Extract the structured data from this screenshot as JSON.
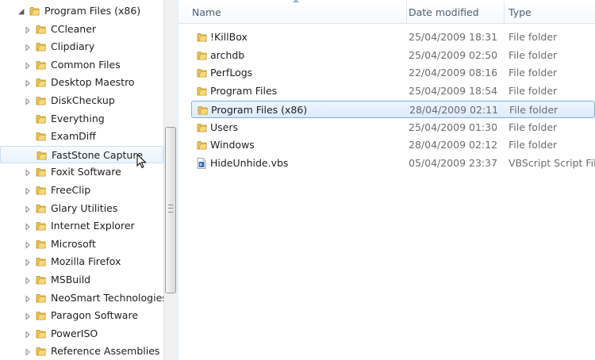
{
  "nav": {
    "items": [
      {
        "label": "Program Files (x86)",
        "expanded": true,
        "indent": 0
      },
      {
        "label": "CCleaner",
        "expandable": true
      },
      {
        "label": "Clipdiary",
        "expandable": true
      },
      {
        "label": "Common Files",
        "expandable": true
      },
      {
        "label": "Desktop Maestro",
        "expandable": true
      },
      {
        "label": "DiskCheckup",
        "expandable": true
      },
      {
        "label": "Everything",
        "expandable": false
      },
      {
        "label": "ExamDiff",
        "expandable": false
      },
      {
        "label": "FastStone Capture",
        "expandable": false,
        "hover": true
      },
      {
        "label": "Foxit Software",
        "expandable": true
      },
      {
        "label": "FreeClip",
        "expandable": true
      },
      {
        "label": "Glary Utilities",
        "expandable": true
      },
      {
        "label": "Internet Explorer",
        "expandable": true
      },
      {
        "label": "Microsoft",
        "expandable": true
      },
      {
        "label": "Mozilla Firefox",
        "expandable": true
      },
      {
        "label": "MSBuild",
        "expandable": true
      },
      {
        "label": "NeoSmart Technologies",
        "expandable": true
      },
      {
        "label": "Paragon Software",
        "expandable": true
      },
      {
        "label": "PowerISO",
        "expandable": true
      },
      {
        "label": "Reference Assemblies",
        "expandable": true
      }
    ]
  },
  "list": {
    "columns": {
      "name": "Name",
      "date": "Date modified",
      "type": "Type"
    },
    "rows": [
      {
        "name": "!KillBox",
        "date": "25/04/2009 18:31",
        "type": "File folder",
        "icon": "folder-icon"
      },
      {
        "name": "archdb",
        "date": "25/04/2009 02:50",
        "type": "File folder",
        "icon": "folder-icon"
      },
      {
        "name": "PerfLogs",
        "date": "22/04/2009 08:16",
        "type": "File folder",
        "icon": "folder-icon"
      },
      {
        "name": "Program Files",
        "date": "25/04/2009 18:54",
        "type": "File folder",
        "icon": "folder-icon"
      },
      {
        "name": "Program Files (x86)",
        "date": "28/04/2009 02:11",
        "type": "File folder",
        "icon": "folder-icon",
        "selected": true
      },
      {
        "name": "Users",
        "date": "25/04/2009 01:30",
        "type": "File folder",
        "icon": "folder-icon"
      },
      {
        "name": "Windows",
        "date": "28/04/2009 02:12",
        "type": "File folder",
        "icon": "folder-icon"
      },
      {
        "name": "HideUnhide.vbs",
        "date": "05/04/2009 23:37",
        "type": "VBScript Script File",
        "icon": "script-file-icon"
      }
    ]
  },
  "colors": {
    "selection_border": "#84acdd",
    "hover_border": "#c9e0f7",
    "header_text": "#4c607a",
    "folder_yellow": "#e8c04a"
  }
}
